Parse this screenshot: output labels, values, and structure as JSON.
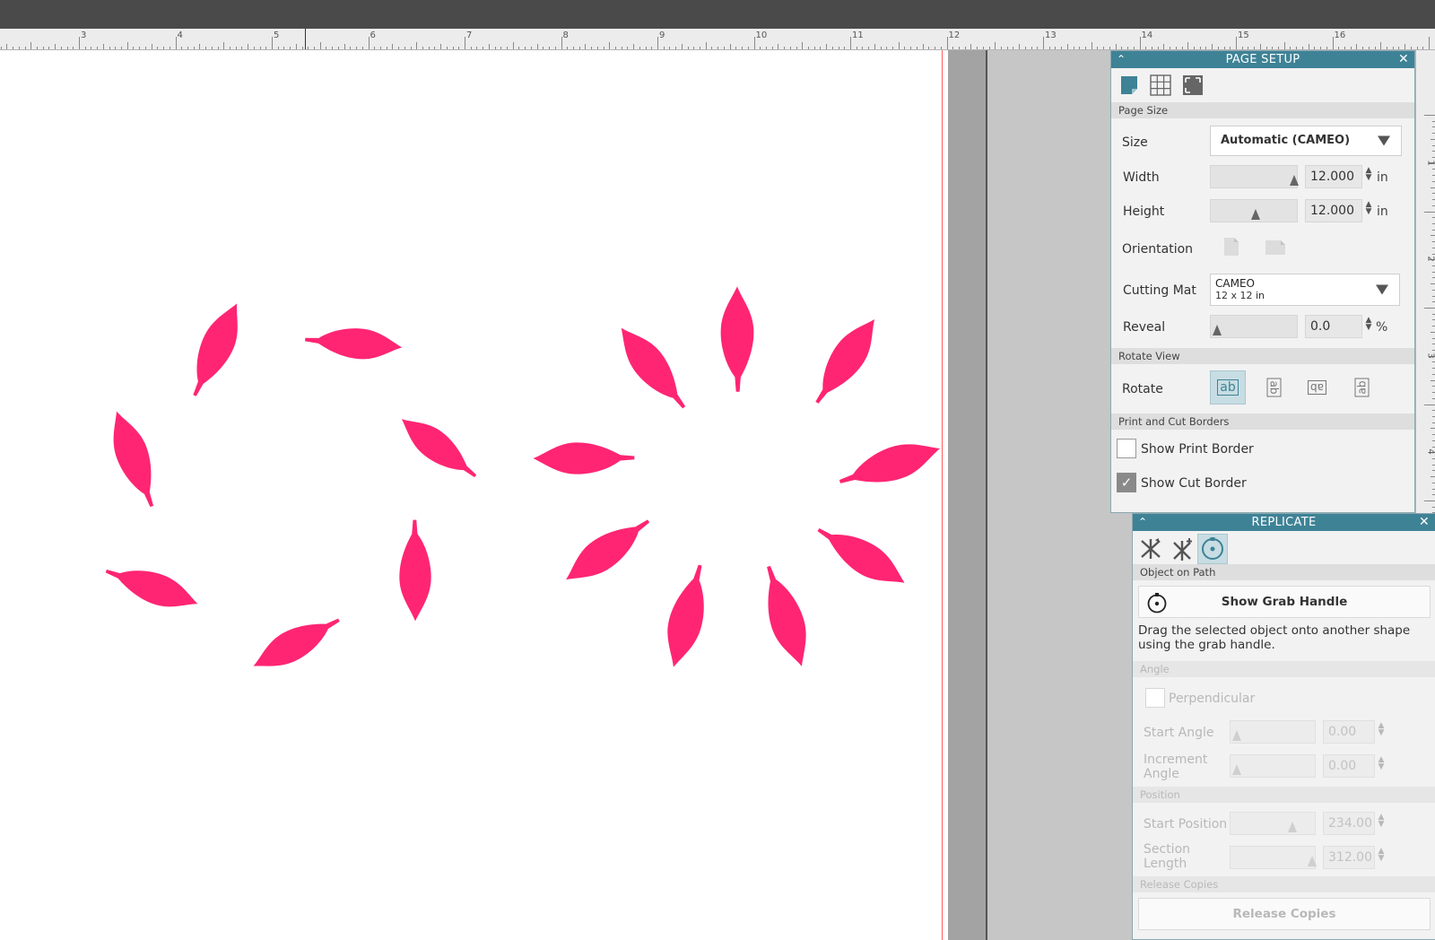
{
  "ruler": {
    "top_numbers": [
      "3",
      "4",
      "5",
      "6",
      "7",
      "8",
      "9",
      "10",
      "11",
      "12",
      "13",
      "14",
      "15",
      "16"
    ],
    "side_numbers": [
      "1",
      "2",
      "3",
      "4",
      "5"
    ]
  },
  "colors": {
    "shape_fill": "#ff2573",
    "panel_header": "#3e8296",
    "cut_border": "#ff5a5a"
  },
  "page_setup": {
    "title": "PAGE SETUP",
    "tab_icons": [
      "page-setup-icon",
      "grid-icon",
      "registration-marks-icon"
    ],
    "section_page_size": "Page Size",
    "size_label": "Size",
    "size_value": "Automatic (CAMEO)",
    "width_label": "Width",
    "width_value": "12.000",
    "width_unit": "in",
    "height_label": "Height",
    "height_value": "12.000",
    "height_unit": "in",
    "orientation_label": "Orientation",
    "cutting_mat_label": "Cutting Mat",
    "cutting_mat_value_line1": "CAMEO",
    "cutting_mat_value_line2": "12 x 12 in",
    "reveal_label": "Reveal",
    "reveal_value": "0.0",
    "reveal_unit": "%",
    "section_rotate_view": "Rotate View",
    "rotate_label": "Rotate",
    "rotate_glyph": "ab",
    "section_borders": "Print and Cut Borders",
    "show_print_border": "Show Print Border",
    "show_print_border_checked": false,
    "show_cut_border": "Show Cut Border",
    "show_cut_border_checked": true
  },
  "replicate": {
    "title": "REPLICATE",
    "tab_icons": [
      "replicate-icon",
      "mirror-replicate-icon",
      "object-on-path-icon"
    ],
    "section_object_on_path": "Object on Path",
    "show_grab_handle": "Show Grab Handle",
    "description": "Drag the selected object onto another shape using the grab handle.",
    "section_angle": "Angle",
    "perpendicular_label": "Perpendicular",
    "start_angle_label": "Start Angle",
    "start_angle_value": "0.00",
    "increment_angle_label_1": "Increment",
    "increment_angle_label_2": "Angle",
    "increment_angle_value": "0.00",
    "section_position": "Position",
    "start_position_label": "Start Position",
    "start_position_value": "234.00",
    "section_length_label_1": "Section",
    "section_length_label_2": "Length",
    "section_length_value": "312.00",
    "section_release": "Release Copies",
    "release_copies_button": "Release Copies"
  }
}
